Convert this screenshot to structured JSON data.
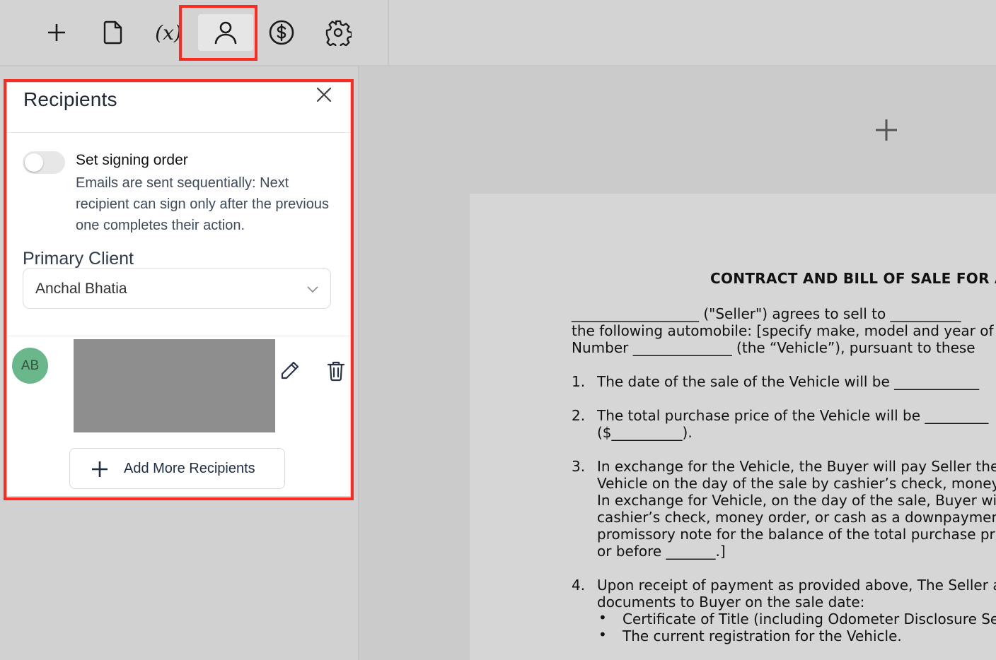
{
  "toolbar": {
    "items": [
      {
        "name": "add",
        "icon": "plus-icon"
      },
      {
        "name": "document",
        "icon": "file-icon"
      },
      {
        "name": "variables",
        "label": "(x)",
        "icon": "variable-icon"
      },
      {
        "name": "recipients",
        "icon": "user-icon",
        "active": true
      },
      {
        "name": "payments",
        "icon": "dollar-circle-icon"
      },
      {
        "name": "settings",
        "icon": "gear-icon"
      }
    ],
    "variables_label": "(x)"
  },
  "recipients_panel": {
    "title": "Recipients",
    "signing_order": {
      "label": "Set signing order",
      "description": "Emails are sent sequentially: Next recipient can sign only after the previous one completes their action.",
      "enabled": false
    },
    "primary_client_label": "Primary Client",
    "primary_client_value": "Anchal Bhatia",
    "recipient": {
      "initials": "AB",
      "avatar_color": "#6ab78c"
    },
    "add_more_label": "Add More Recipients"
  },
  "document": {
    "title": "CONTRACT AND BILL OF SALE FOR A",
    "intro_lines": [
      "__________________ (\"Seller\") agrees to sell to __________",
      "the following automobile: [specify make, model and year of",
      "Number ______________ (the “Vehicle”), pursuant to these"
    ],
    "items": [
      {
        "num": "1.",
        "lines": [
          "The date of the sale of the Vehicle will be ____________"
        ]
      },
      {
        "num": "2.",
        "lines": [
          "The total purchase price of the Vehicle will be _________",
          "($__________)."
        ]
      },
      {
        "num": "3.",
        "lines": [
          "In exchange for the Vehicle, the Buyer will pay Seller the",
          "Vehicle on the day of the sale by cashier’s check, money",
          "In exchange for Vehicle, on the day of the sale, Buyer wi",
          "cashier’s check, money order, or cash as a downpaymen",
          "promissory note for the balance of the total purchase pri",
          "or before _______.]"
        ]
      },
      {
        "num": "4.",
        "lines": [
          "Upon receipt of payment as provided above, The Seller a",
          "documents to Buyer on the sale date:"
        ]
      }
    ],
    "bullets": [
      "Certificate of Title (including Odometer Disclosure Se",
      "The current registration for the Vehicle."
    ],
    "bullet_char": "•"
  },
  "colors": {
    "highlight": "#ff2a1f",
    "avatar": "#6ab78c",
    "redaction": "#8e8e8e"
  }
}
